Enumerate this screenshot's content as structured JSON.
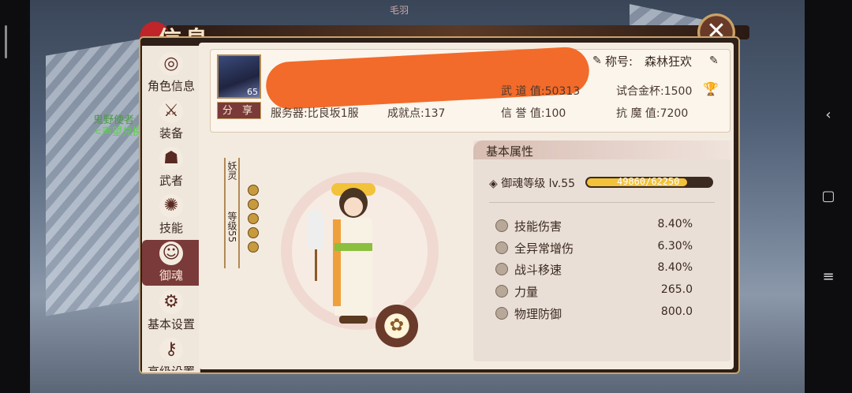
{
  "window": {
    "title": "信息",
    "top_name": "毛羽"
  },
  "sidebar": {
    "items": [
      {
        "label": "角色信息",
        "icon": "character-info-icon",
        "active": false
      },
      {
        "label": "装备",
        "icon": "swords-icon",
        "active": false
      },
      {
        "label": "武者",
        "icon": "samurai-icon",
        "active": false
      },
      {
        "label": "技能",
        "icon": "skill-swirl-icon",
        "active": false
      },
      {
        "label": "御魂",
        "icon": "spirit-face-icon",
        "active": true
      },
      {
        "label": "基本设置",
        "icon": "gear-icon",
        "active": false
      },
      {
        "label": "高级设置",
        "icon": "key-gear-icon",
        "active": false
      }
    ]
  },
  "background": {
    "npc_name_1": "鬼野使者",
    "npc_name_2": "<声望兑换"
  },
  "profile": {
    "avatar_level": "65",
    "share_label": "分 享",
    "title_label": "称号:",
    "title_value": "森林狂欢",
    "server": "服务器:比良坂1服",
    "achievement": "成就点:137",
    "martial": "武 道 值:50313",
    "cup": "试合金杯:1500",
    "reputation": "信 誉 值:100",
    "demon": "抗 魔 值:7200"
  },
  "character": {
    "plaque_top": "妖灵",
    "plaque_bottom": "等级55",
    "coins": 5
  },
  "attributes": {
    "header": "基本属性",
    "soul_label": "御魂等级",
    "soul_level": "lv.55",
    "soul_exp": "49860/62250",
    "soul_progress": 0.801,
    "rows": [
      {
        "name": "技能伤害",
        "value": "8.40%"
      },
      {
        "name": "全异常增伤",
        "value": "6.30%"
      },
      {
        "name": "战斗移速",
        "value": "8.40%"
      },
      {
        "name": "力量",
        "value": "265.0"
      },
      {
        "name": "物理防御",
        "value": "800.0"
      }
    ]
  },
  "colors": {
    "accent": "#7a3a3a",
    "gold": "#c9a46a",
    "bar": "#f2c23a",
    "scribble": "#f26b2a"
  }
}
